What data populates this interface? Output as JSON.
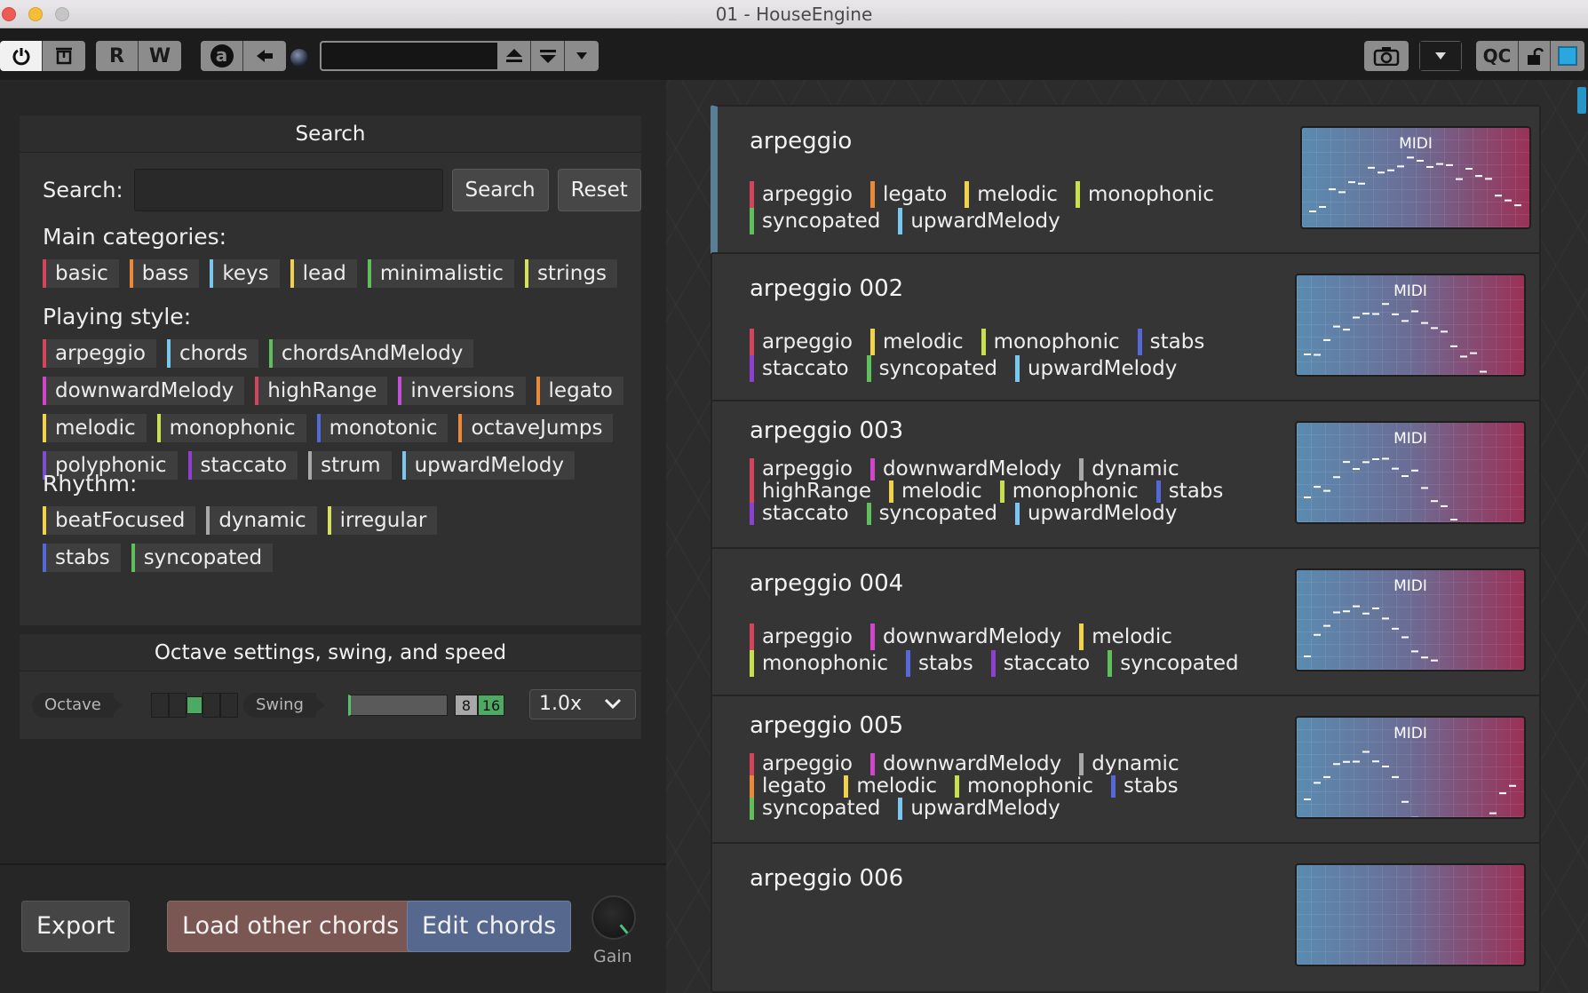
{
  "window": {
    "title": "01 - HouseEngine"
  },
  "toolbar": {
    "record_label": "R",
    "write_label": "W",
    "auto_label": "a",
    "qc_label": "QC"
  },
  "search": {
    "title": "Search",
    "label": "Search:",
    "value": "",
    "search_button": "Search",
    "reset_button": "Reset"
  },
  "categories": [
    {
      "label": "Main categories:",
      "chips": [
        {
          "text": "basic",
          "color": "#d4445a"
        },
        {
          "text": "bass",
          "color": "#e98a3a"
        },
        {
          "text": "keys",
          "color": "#79c7ee"
        },
        {
          "text": "lead",
          "color": "#f0d34a"
        },
        {
          "text": "minimalistic",
          "color": "#5fbf5a"
        },
        {
          "text": "strings",
          "color": "#d7e25a"
        }
      ]
    },
    {
      "label": "Playing style:",
      "chips": [
        {
          "text": "arpeggio",
          "color": "#d4445a"
        },
        {
          "text": "chords",
          "color": "#79c7ee"
        },
        {
          "text": "chordsAndMelody",
          "color": "#5fbf5a"
        },
        {
          "text": "downwardMelody",
          "color": "#d145c9"
        },
        {
          "text": "highRange",
          "color": "#d4445a"
        },
        {
          "text": "inversions",
          "color": "#c14fd7"
        },
        {
          "text": "legato",
          "color": "#e98a3a"
        },
        {
          "text": "melodic",
          "color": "#f0d34a"
        },
        {
          "text": "monophonic",
          "color": "#c8e04d"
        },
        {
          "text": "monotonic",
          "color": "#5468d8"
        },
        {
          "text": "octaveJumps",
          "color": "#e98a3a"
        },
        {
          "text": "polyphonic",
          "color": "#7a4fd0"
        },
        {
          "text": "staccato",
          "color": "#8d3fcf"
        },
        {
          "text": "strum",
          "color": "#a8a8a8"
        },
        {
          "text": "upwardMelody",
          "color": "#79c7ee"
        }
      ]
    },
    {
      "label": "Rhythm:",
      "chips": [
        {
          "text": "beatFocused",
          "color": "#f0d34a"
        },
        {
          "text": "dynamic",
          "color": "#a8a8a8"
        },
        {
          "text": "irregular",
          "color": "#d7e25a"
        },
        {
          "text": "stabs",
          "color": "#5468d8"
        },
        {
          "text": "syncopated",
          "color": "#5fbf5a"
        }
      ]
    }
  ],
  "octave_section": {
    "title": "Octave settings, swing, and speed",
    "octave_label": "Octave",
    "octave_selected": 3,
    "swing_label": "Swing",
    "swing_value": 0,
    "swing_opt_8": "8",
    "swing_opt_16": "16",
    "speed_value": "1.0x"
  },
  "bottom": {
    "export": "Export",
    "load_other": "Load other chords",
    "edit": "Edit chords",
    "gain_label": "Gain"
  },
  "presets": [
    {
      "name": "arpeggio",
      "selected": true,
      "midi_label": "MIDI",
      "tags": [
        {
          "text": "arpeggio",
          "color": "#d4445a"
        },
        {
          "text": "legato",
          "color": "#e98a3a"
        },
        {
          "text": "melodic",
          "color": "#f0d34a"
        },
        {
          "text": "monophonic",
          "color": "#c8e04d"
        },
        {
          "text": "syncopated",
          "color": "#5fbf5a"
        },
        {
          "text": "upwardMelody",
          "color": "#79c7ee"
        }
      ]
    },
    {
      "name": "arpeggio 002",
      "selected": false,
      "midi_label": "MIDI",
      "tags": [
        {
          "text": "arpeggio",
          "color": "#d4445a"
        },
        {
          "text": "melodic",
          "color": "#f0d34a"
        },
        {
          "text": "monophonic",
          "color": "#c8e04d"
        },
        {
          "text": "stabs",
          "color": "#5468d8"
        },
        {
          "text": "staccato",
          "color": "#8d3fcf"
        },
        {
          "text": "syncopated",
          "color": "#5fbf5a"
        },
        {
          "text": "upwardMelody",
          "color": "#79c7ee"
        }
      ]
    },
    {
      "name": "arpeggio 003",
      "selected": false,
      "midi_label": "MIDI",
      "tags": [
        {
          "text": "arpeggio",
          "color": "#d4445a"
        },
        {
          "text": "downwardMelody",
          "color": "#d145c9"
        },
        {
          "text": "dynamic",
          "color": "#a8a8a8"
        },
        {
          "text": "highRange",
          "color": "#d4445a"
        },
        {
          "text": "melodic",
          "color": "#f0d34a"
        },
        {
          "text": "monophonic",
          "color": "#c8e04d"
        },
        {
          "text": "stabs",
          "color": "#5468d8"
        },
        {
          "text": "staccato",
          "color": "#8d3fcf"
        },
        {
          "text": "syncopated",
          "color": "#5fbf5a"
        },
        {
          "text": "upwardMelody",
          "color": "#79c7ee"
        }
      ]
    },
    {
      "name": "arpeggio 004",
      "selected": false,
      "midi_label": "MIDI",
      "tags": [
        {
          "text": "arpeggio",
          "color": "#d4445a"
        },
        {
          "text": "downwardMelody",
          "color": "#d145c9"
        },
        {
          "text": "melodic",
          "color": "#f0d34a"
        },
        {
          "text": "monophonic",
          "color": "#c8e04d"
        },
        {
          "text": "stabs",
          "color": "#5468d8"
        },
        {
          "text": "staccato",
          "color": "#8d3fcf"
        },
        {
          "text": "syncopated",
          "color": "#5fbf5a"
        }
      ]
    },
    {
      "name": "arpeggio 005",
      "selected": false,
      "midi_label": "MIDI",
      "tags": [
        {
          "text": "arpeggio",
          "color": "#d4445a"
        },
        {
          "text": "downwardMelody",
          "color": "#d145c9"
        },
        {
          "text": "dynamic",
          "color": "#a8a8a8"
        },
        {
          "text": "legato",
          "color": "#e98a3a"
        },
        {
          "text": "melodic",
          "color": "#f0d34a"
        },
        {
          "text": "monophonic",
          "color": "#c8e04d"
        },
        {
          "text": "stabs",
          "color": "#5468d8"
        },
        {
          "text": "syncopated",
          "color": "#5fbf5a"
        },
        {
          "text": "upwardMelody",
          "color": "#79c7ee"
        }
      ]
    },
    {
      "name": "arpeggio 006",
      "selected": false,
      "midi_label": "",
      "tags": []
    }
  ]
}
